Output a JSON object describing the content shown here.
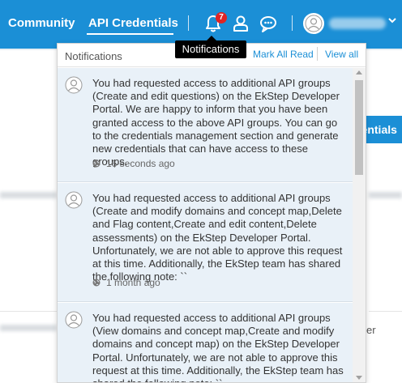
{
  "nav": {
    "community": "Community",
    "api_credentials": "API Credentials",
    "notification_count": "7",
    "icons": [
      "bell-icon",
      "user-icon",
      "chat-icon",
      "avatar-icon",
      "chevron-down-icon"
    ],
    "accent_color": "#1b8fd6",
    "badge_color": "#e02424"
  },
  "tooltip": {
    "text": "Notifications"
  },
  "background": {
    "button_fragment": "dentials",
    "right_text": "er"
  },
  "notifications": {
    "title": "Notifications",
    "mark_all_read": "Mark All Read",
    "view_all": "View all",
    "items": [
      {
        "text": "You had requested access to additional API groups (Create and edit questions) on the EkStep Developer Portal. We are happy to inform that you have been granted access to the above API groups. You can go to the credentials management section and generate new credentials that can have access to these groups.",
        "time": "16 seconds ago"
      },
      {
        "text": "You had requested access to additional API groups (Create and modify domains and concept map,Delete and Flag content,Create and edit content,Delete assessments) on the EkStep Developer Portal. Unfortunately, we are not able to approve this request at this time. Additionally, the EkStep team has shared the following note: ``",
        "time": "1 month ago"
      },
      {
        "text": "You had requested access to additional API groups (View domains and concept map,Create and modify domains and concept map) on the EkStep Developer Portal. Unfortunately, we are not able to approve this request at this time. Additionally, the EkStep team has shared the following note: ``",
        "time": ""
      }
    ]
  }
}
